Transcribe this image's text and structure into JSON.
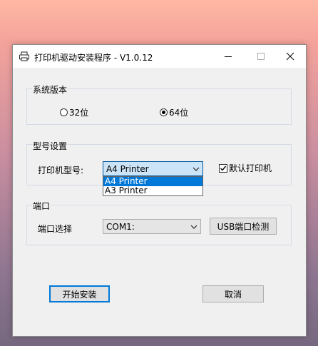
{
  "window": {
    "title": "打印机驱动安装程序 - V1.0.12",
    "icon": "printer-icon",
    "controls": [
      "minimize-icon",
      "maximize-icon",
      "close-icon"
    ]
  },
  "system_version": {
    "group_label": "系统版本",
    "options": [
      {
        "label": "32位",
        "selected": false
      },
      {
        "label": "64位",
        "selected": true
      }
    ]
  },
  "model_settings": {
    "group_label": "型号设置",
    "printer_model_label": "打印机型号:",
    "selected_value": "A4 Printer",
    "dropdown_open": true,
    "options": [
      "A4 Printer",
      "A3 Printer"
    ],
    "highlighted_option": "A4 Printer",
    "default_printer_label": "默认打印机",
    "default_printer_checked": true
  },
  "port": {
    "group_label": "端口",
    "port_select_label": "端口选择",
    "selected_value": "COM1:",
    "detect_button_label": "USB端口检测"
  },
  "actions": {
    "install_label": "开始安装",
    "cancel_label": "取消"
  },
  "colors": {
    "accent": "#0078d7",
    "dropdown_highlight": "#0078d7",
    "open_select_bg": "#cce4f7"
  }
}
